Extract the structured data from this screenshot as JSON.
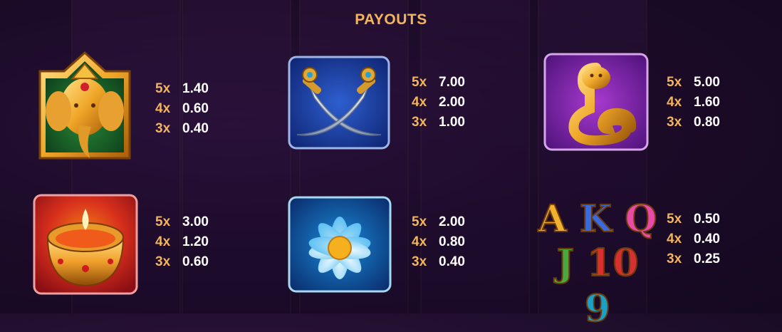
{
  "title": "PAYOUTS",
  "symbols": [
    {
      "name": "ganesha",
      "payouts": [
        {
          "mult": "5x",
          "value": "1.40"
        },
        {
          "mult": "4x",
          "value": "0.60"
        },
        {
          "mult": "3x",
          "value": "0.40"
        }
      ]
    },
    {
      "name": "crossed-daggers",
      "payouts": [
        {
          "mult": "5x",
          "value": "7.00"
        },
        {
          "mult": "4x",
          "value": "2.00"
        },
        {
          "mult": "3x",
          "value": "1.00"
        }
      ]
    },
    {
      "name": "golden-cobra",
      "payouts": [
        {
          "mult": "5x",
          "value": "5.00"
        },
        {
          "mult": "4x",
          "value": "1.60"
        },
        {
          "mult": "3x",
          "value": "0.80"
        }
      ]
    },
    {
      "name": "diya-lamp",
      "payouts": [
        {
          "mult": "5x",
          "value": "3.00"
        },
        {
          "mult": "4x",
          "value": "1.20"
        },
        {
          "mult": "3x",
          "value": "0.60"
        }
      ]
    },
    {
      "name": "blue-lotus",
      "payouts": [
        {
          "mult": "5x",
          "value": "2.00"
        },
        {
          "mult": "4x",
          "value": "0.80"
        },
        {
          "mult": "3x",
          "value": "0.40"
        }
      ]
    },
    {
      "name": "card-royals",
      "letters_row1": [
        "A",
        "K",
        "Q"
      ],
      "letters_row2": [
        "J",
        "10",
        "9"
      ],
      "payouts": [
        {
          "mult": "5x",
          "value": "0.50"
        },
        {
          "mult": "4x",
          "value": "0.40"
        },
        {
          "mult": "3x",
          "value": "0.25"
        }
      ]
    }
  ],
  "colors": {
    "accent": "#f2b45e",
    "value": "#ffffff",
    "background": "#241032"
  }
}
